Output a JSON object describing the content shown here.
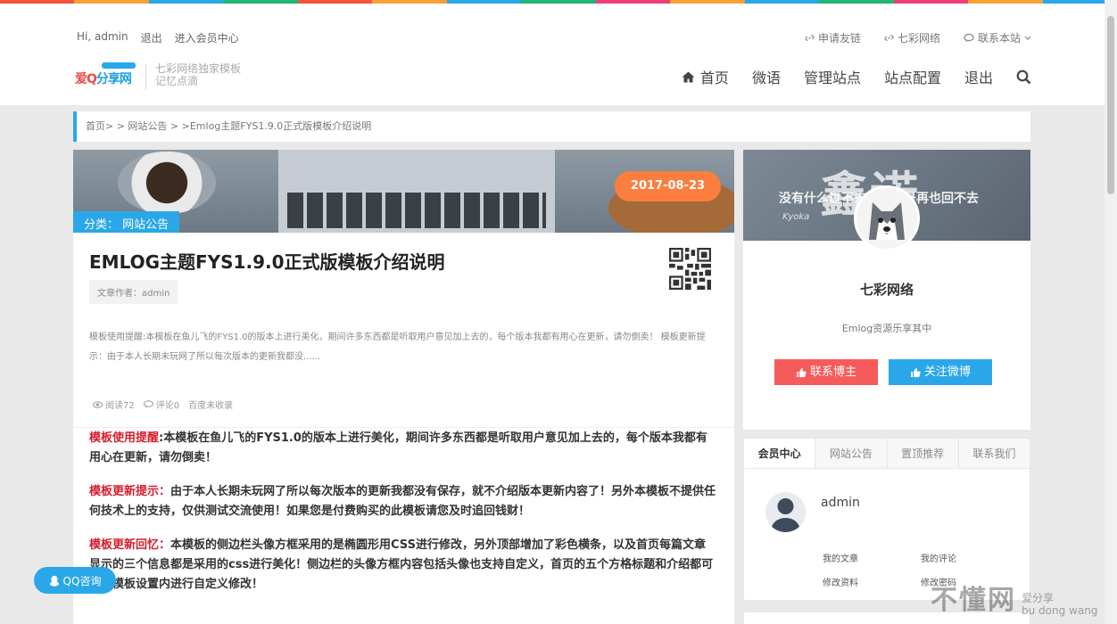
{
  "rainbow_colors": [
    "#f1553c",
    "#f7a134",
    "#2aa7e8",
    "#22b573",
    "#f1553c",
    "#f7a134",
    "#2aa7e8",
    "#22b573",
    "#ec3e7a",
    "#f7a134",
    "#2aa7e8",
    "#22b573",
    "#ec3e7a",
    "#f7a134",
    "#2aa7e8"
  ],
  "topbar": {
    "greeting": "Hi, admin",
    "logout": "退出",
    "member_center": "进入会员中心",
    "links": [
      {
        "label": "申请友链",
        "icon": "link-icon"
      },
      {
        "label": "七彩网络",
        "icon": "link-icon"
      },
      {
        "label": "联系本站",
        "icon": "chat-icon"
      }
    ]
  },
  "logo": {
    "text_a": "爱Q",
    "text_b": "分享网"
  },
  "tagline": {
    "line1": "七彩网络独家模板",
    "line2": "记忆点滴"
  },
  "nav": {
    "home": "首页",
    "items": [
      "微语",
      "管理站点",
      "站点配置",
      "退出"
    ]
  },
  "breadcrumb": "首页> > 网站公告 > >Emlog主题FYS1.9.0正式版模板介绍说明",
  "post": {
    "date": "2017-08-23",
    "category": "分类： 网站公告",
    "title": "EMLOG主题FYS1.9.0正式版模板介绍说明",
    "author": "文章作者：admin",
    "excerpt": "模板使用提醒:本模板在鱼儿飞的FYS1.0的版本上进行美化，期间许多东西都是听取用户意见加上去的，每个版本我都有用心在更新，请勿倒卖！ 模板更新提示：由于本人长期未玩网了所以每次版本的更新我都没......",
    "views": "阅读72",
    "comments": "评论0",
    "index_status": "百度未收录"
  },
  "content": [
    {
      "label": "模板使用提醒",
      "text": ":本模板在鱼儿飞的FYS1.0的版本上进行美化，期间许多东西都是听取用户意见加上去的，每个版本我都有用心在更新，请勿倒卖！"
    },
    {
      "label": "模板更新提示：",
      "text": "由于本人长期未玩网了所以每次版本的更新我都没有保存，就不介绍版本更新内容了！另外本模板不提供任何技术上的支持，仅供测试交流使用！如果您是付费购买的此模板请您及时追回钱财！"
    },
    {
      "label": "模板更新回忆：",
      "text": "本模板的侧边栏头像方框采用的是椭圆形用CSS进行修改，另外顶部增加了彩色横条，以及首页每篇文章显示的三个信息都是采用的css进行美化！侧边栏的头像方框内容包括头像也支持自定义，首页的五个方格标题和介绍都可以在模板设置内进行自定义修改！"
    }
  ],
  "profile": {
    "cover_big": "鑫诺",
    "cover_small": "没有什么过不去的，只是再也回不去",
    "cover_sign": "Kyoka",
    "name": "七彩网络",
    "desc": "Emlog资源乐享其中",
    "btn_contact": "联系博主",
    "btn_follow": "关注微博"
  },
  "member": {
    "tabs": [
      "会员中心",
      "网站公告",
      "置顶推荐",
      "联系我们"
    ],
    "username": "admin",
    "links": [
      "我的文章",
      "我的评论",
      "修改资料",
      "修改密码"
    ]
  },
  "qq_button": "QQ咨询",
  "watermark": {
    "big": "不懂网",
    "small": "爱分享",
    "pinyin": "bu dong wang"
  }
}
